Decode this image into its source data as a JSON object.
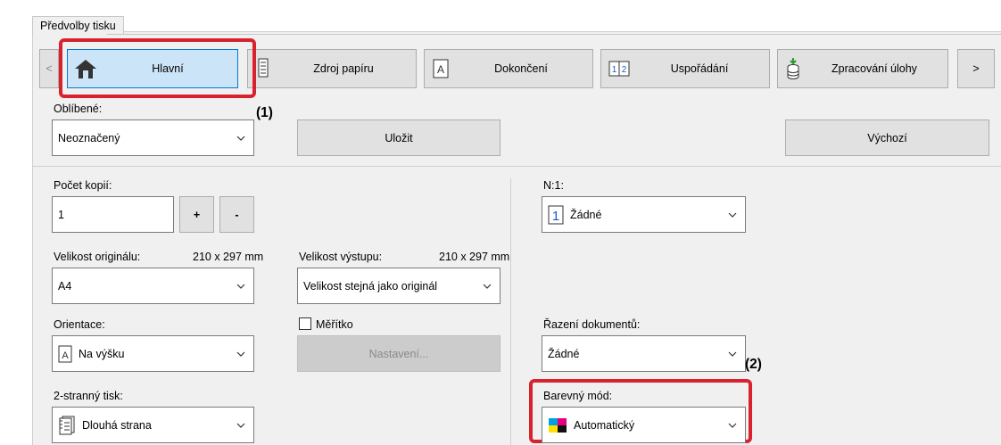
{
  "panel_tab": "Předvolby tisku",
  "nav": {
    "prev": "<",
    "next": ">",
    "tabs": [
      {
        "label": "Hlavní",
        "icon": "home-icon"
      },
      {
        "label": "Zdroj papíru",
        "icon": "paper-source-icon"
      },
      {
        "label": "Dokončení",
        "icon": "finishing-icon"
      },
      {
        "label": "Uspořádání",
        "icon": "layout-icon"
      },
      {
        "label": "Zpracování úlohy",
        "icon": "job-handling-icon"
      }
    ]
  },
  "callouts": {
    "c1": "(1)",
    "c2": "(2)"
  },
  "favorites": {
    "label": "Oblíbené:",
    "value": "Neoznačený",
    "save": "Uložit",
    "default": "Výchozí"
  },
  "copies": {
    "label": "Počet kopií:",
    "value": "1",
    "plus": "+",
    "minus": "-"
  },
  "original_size": {
    "label": "Velikost originálu:",
    "dims": "210 x 297 mm",
    "value": "A4"
  },
  "output_size": {
    "label": "Velikost výstupu:",
    "dims": "210 x 297 mm",
    "value": "Velikost stejná jako originál"
  },
  "orientation": {
    "label": "Orientace:",
    "value": "Na výšku",
    "icon_letter": "A"
  },
  "scale": {
    "label": "Měřítko",
    "checked": false,
    "settings": "Nastavení..."
  },
  "duplex": {
    "label": "2-stranný tisk:",
    "value": "Dlouhá strana"
  },
  "nup": {
    "label": "N:1:",
    "value": "Žádné",
    "icon_num": "1"
  },
  "collate": {
    "label": "Řazení dokumentů:",
    "value": "Žádné"
  },
  "color_mode": {
    "label": "Barevný mód:",
    "value": "Automatický"
  },
  "colors": {
    "highlight": "#d8232f",
    "active_tab": "#cce4f7"
  }
}
